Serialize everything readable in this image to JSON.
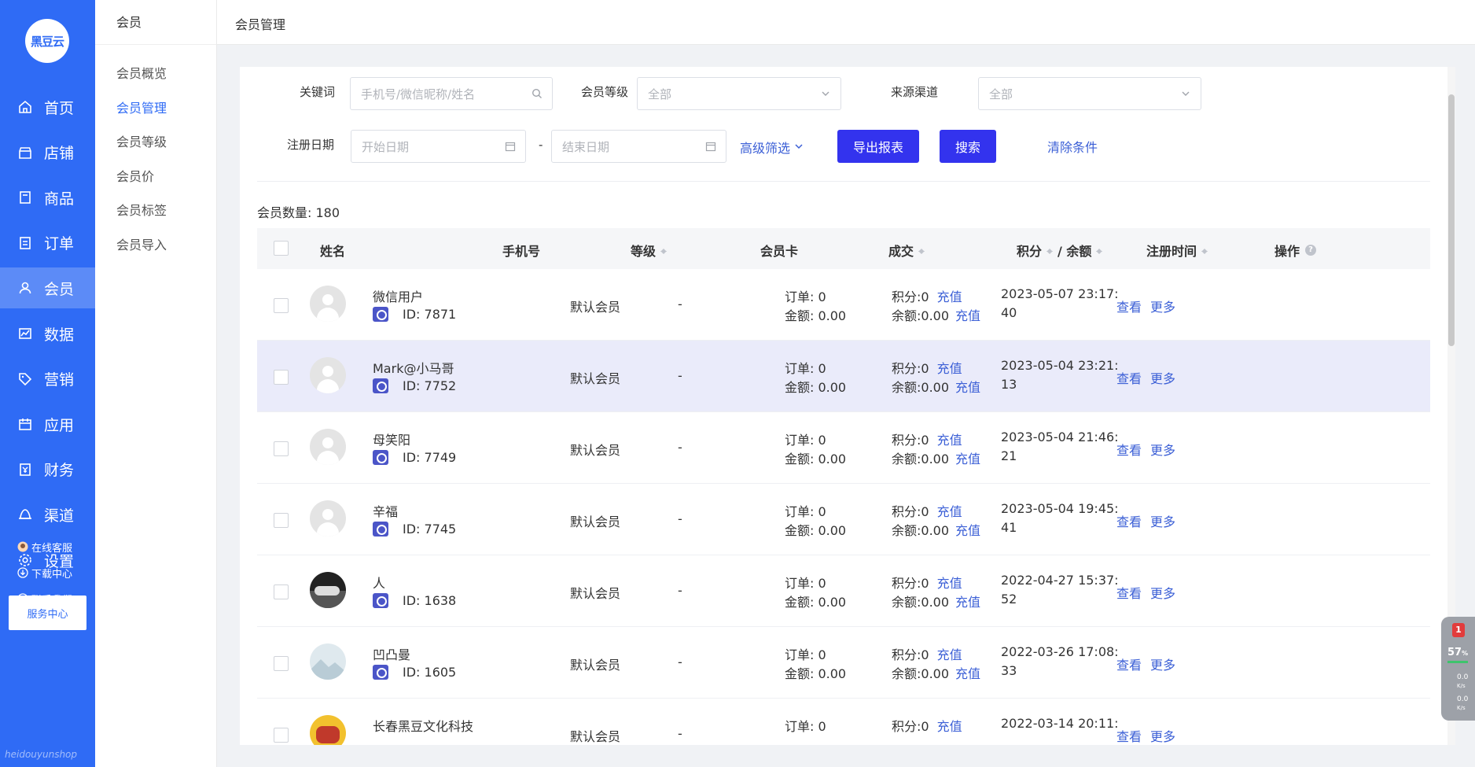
{
  "app": {
    "logo_text": "黑豆云",
    "brand_watermark": "heidouyunshop"
  },
  "nav": {
    "items": [
      {
        "label": "首页",
        "icon": "home-icon"
      },
      {
        "label": "店铺",
        "icon": "store-icon"
      },
      {
        "label": "商品",
        "icon": "product-icon"
      },
      {
        "label": "订单",
        "icon": "order-icon"
      },
      {
        "label": "会员",
        "icon": "member-icon"
      },
      {
        "label": "数据",
        "icon": "chart-icon"
      },
      {
        "label": "营销",
        "icon": "tag-icon"
      },
      {
        "label": "应用",
        "icon": "app-icon"
      },
      {
        "label": "财务",
        "icon": "finance-icon"
      },
      {
        "label": "渠道",
        "icon": "channel-icon"
      },
      {
        "label": "设置",
        "icon": "gear-icon"
      }
    ],
    "active": "会员",
    "service_center": "服务中心",
    "links": [
      {
        "label": "在线客服",
        "icon": "avatar-icon"
      },
      {
        "label": "下载中心",
        "icon": "download-icon"
      },
      {
        "label": "联系我们",
        "icon": "chat-icon"
      }
    ]
  },
  "subnav": {
    "title": "会员",
    "items": [
      "会员概览",
      "会员管理",
      "会员等级",
      "会员价",
      "会员标签",
      "会员导入"
    ],
    "active": "会员管理"
  },
  "header": {
    "title": "会员管理"
  },
  "filters": {
    "keyword_label": "关键词",
    "keyword_placeholder": "手机号/微信昵称/姓名",
    "level_label": "会员等级",
    "level_value": "全部",
    "source_label": "来源渠道",
    "source_value": "全部",
    "date_label": "注册日期",
    "start_placeholder": "开始日期",
    "date_separator": "-",
    "end_placeholder": "结束日期",
    "advanced": "高级筛选",
    "export": "导出报表",
    "search": "搜索",
    "clear": "清除条件"
  },
  "count_label": "会员数量:  180",
  "table": {
    "columns": [
      "姓名",
      "手机号",
      "等级",
      "会员卡",
      "成交",
      "积分",
      "/ 余额",
      "注册时间",
      "操作"
    ],
    "rows": [
      {
        "name": "微信用户",
        "id": "ID: 7871",
        "level": "默认会员",
        "card": "-",
        "orders": "订单:  0",
        "amount": "金额:  0.00",
        "points": "积分:0",
        "balance": "余额:0.00",
        "recharge": "充值",
        "time1": "2023-05-07 23:17:",
        "time2": "40",
        "view": "查看",
        "more": "更多",
        "avatar": "default"
      },
      {
        "name": "Mark@小马哥",
        "id": "ID: 7752",
        "level": "默认会员",
        "card": "-",
        "orders": "订单:  0",
        "amount": "金额:  0.00",
        "points": "积分:0",
        "balance": "余额:0.00",
        "recharge": "充值",
        "time1": "2023-05-04 23:21:",
        "time2": "13",
        "view": "查看",
        "more": "更多",
        "avatar": "default"
      },
      {
        "name": "母笑阳",
        "id": "ID: 7749",
        "level": "默认会员",
        "card": "-",
        "orders": "订单:  0",
        "amount": "金额:  0.00",
        "points": "积分:0",
        "balance": "余额:0.00",
        "recharge": "充值",
        "time1": "2023-05-04 21:46:",
        "time2": "21",
        "view": "查看",
        "more": "更多",
        "avatar": "default"
      },
      {
        "name": "辛福",
        "id": "ID: 7745",
        "level": "默认会员",
        "card": "-",
        "orders": "订单:  0",
        "amount": "金额:  0.00",
        "points": "积分:0",
        "balance": "余额:0.00",
        "recharge": "充值",
        "time1": "2023-05-04 19:45:",
        "time2": "41",
        "view": "查看",
        "more": "更多",
        "avatar": "default"
      },
      {
        "name": "人",
        "id": "ID: 1638",
        "level": "默认会员",
        "card": "-",
        "orders": "订单:  0",
        "amount": "金额:  0.00",
        "points": "积分:0",
        "balance": "余额:0.00",
        "recharge": "充值",
        "time1": "2022-04-27 15:37:",
        "time2": "52",
        "view": "查看",
        "more": "更多",
        "avatar": "photo-car"
      },
      {
        "name": "凹凸曼",
        "id": "ID: 1605",
        "level": "默认会员",
        "card": "-",
        "orders": "订单:  0",
        "amount": "金额:  0.00",
        "points": "积分:0",
        "balance": "余额:0.00",
        "recharge": "充值",
        "time1": "2022-03-26 17:08:",
        "time2": "33",
        "view": "查看",
        "more": "更多",
        "avatar": "photo-landscape"
      },
      {
        "name": "长春黑豆文化科技",
        "id": "",
        "level": "默认会员",
        "card": "-",
        "orders": "订单:  0",
        "amount": "",
        "points": "积分:0",
        "balance": "",
        "recharge": "充值",
        "time1": "2022-03-14 20:11:",
        "time2": "",
        "view": "查看",
        "more": "更多",
        "avatar": "photo-red"
      }
    ]
  },
  "widget": {
    "badge": "1",
    "percent": "57",
    "unit": "%",
    "up": "0.0",
    "down": "0.0",
    "rate_unit": "K/s"
  },
  "colors": {
    "primary": "#2f6bf5",
    "button": "#3333ee",
    "link": "#3b5fd6",
    "highlight_row": "#eaebfa"
  }
}
